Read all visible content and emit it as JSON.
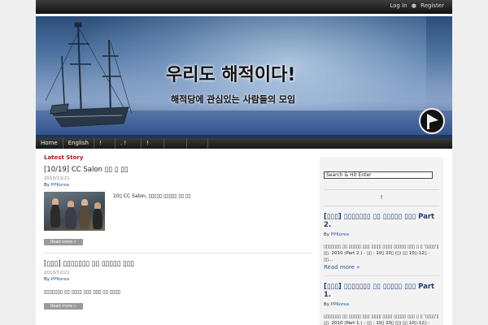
{
  "header": {
    "login": "Log In",
    "register": "Register",
    "site_title": "우리도 해적이다!",
    "site_description": "해적당에 관심있는 사람들의 모임"
  },
  "nav": {
    "items": [
      "Home",
      "English",
      "!",
      ".  !",
      "!",
      "",
      ""
    ]
  },
  "main": {
    "section_title": "Latest Story",
    "posts": [
      {
        "title": "[10/19] CC Salon ▯▯ ▯ ▯▯",
        "date": "2010/12/21",
        "by": "By",
        "author": "PPKorea",
        "excerpt": "10▯ CC Salon, ▯▯▯▯▯ ▯▯▯▯▯ ▯▯ ▯▯",
        "read_more": "Read more »"
      },
      {
        "title": "[▯▯▯] ▯▯▯▯▯▯▯ ▯▯ ▯▯▯▯▯ ▯▯▯",
        "date": "2010/12/21",
        "by": "By",
        "author": "PPKorea",
        "excerpt": "▯▯▯▯▯▯▯ ▯▯ ▯▯▯▯ ▯▯▯ ▯▯▯ ▯▯ ▯▯▯▯",
        "read_more": "Read more »"
      }
    ]
  },
  "sidebar": {
    "search_value": "Search & Hit Enter",
    "heading": "!",
    "posts": [
      {
        "title": "[▯▯▯] ▯▯▯▯▯▯▯ ▯▯ ▯▯▯▯▯ ▯▯▯ Part 2.",
        "by": "By",
        "author": "PPKorea",
        "excerpt": "▯▯▯▯▯▯▯ ▯▯ ▯▯▯▯▯ ▯▯▯ ▯▯▯▯ ▯▯▯▯ ▯▯▯▯▯ ▯▯▯ ▯ ▯ '▯▯▯▯'▯ ▯▯. 2010 (Part 2.) - ▯▯ : 10▯ 20▯ (▯) ▯▯ 10▯-12▯ - ▯▯...",
        "read_more": "Read more »"
      },
      {
        "title": "[▯▯▯] ▯▯▯▯▯▯▯ ▯▯ ▯▯▯▯▯ ▯▯▯ Part 1.",
        "by": "By",
        "author": "PPKorea",
        "excerpt": "▯▯▯▯▯▯▯ ▯▯ ▯▯▯▯▯ ▯▯▯ ▯▯▯▯ ▯▯▯▯ ▯▯▯▯▯ ▯▯▯ ▯ ▯ '▯▯▯▯'▯ ▯▯. 2010 (Part 1.) - ▯▯ : 10▯ 20▯ (▯) ▯▯ 10▯-12▯ - ▯▯..."
      }
    ]
  },
  "colors": {
    "accent_red": "#b31b1b",
    "link_blue": "#2a5aa0",
    "title_navy": "#1c3d7a"
  }
}
